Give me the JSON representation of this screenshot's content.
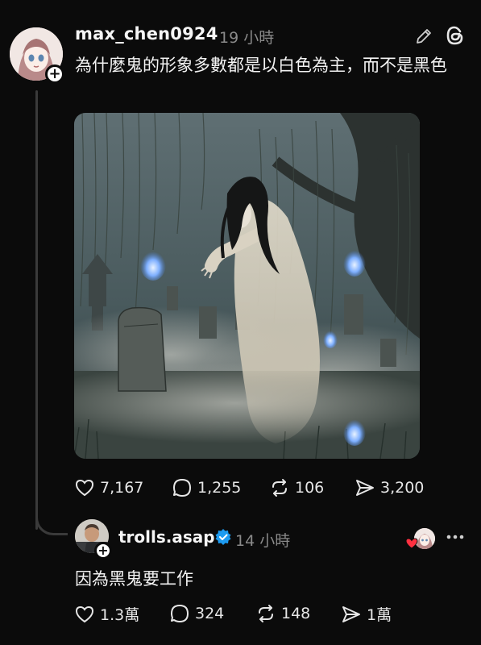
{
  "post": {
    "username": "max_chen0924",
    "time": "19 小時",
    "text": "為什麼鬼的形象多數都是以白色為主，而不是黑色",
    "actions": {
      "likes": "7,167",
      "comments": "1,255",
      "reposts": "106",
      "shares": "3,200"
    }
  },
  "reply": {
    "username": "trolls.asap",
    "time": "14 小時",
    "text": "因為黑鬼要工作",
    "actions": {
      "likes": "1.3萬",
      "comments": "324",
      "reposts": "148",
      "shares": "1萬"
    }
  },
  "icons": {
    "like": "heart-icon",
    "comment": "comment-bubble-icon",
    "repost": "repost-icon",
    "share": "send-icon",
    "edit": "pencil-icon",
    "app": "threads-logo-icon",
    "more": "more-dots-icon",
    "verified": "verified-badge-icon"
  },
  "colors": {
    "background": "#0b0b0b",
    "text": "#f3f3f3",
    "muted": "#8a8a8a",
    "verified": "#1d9bf0",
    "heart": "#ff3040"
  }
}
